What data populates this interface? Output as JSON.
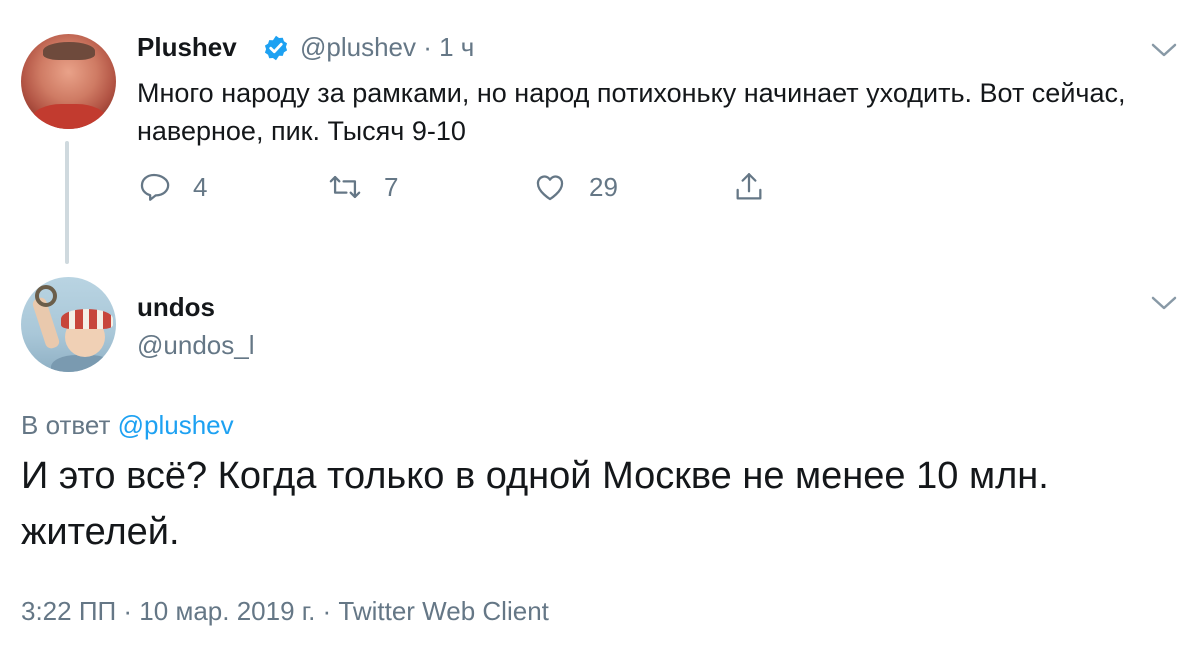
{
  "parent_tweet": {
    "author_name": "Plushev",
    "handle_time": "@plushev · 1 ч",
    "text": "Много народу за рамками, но народ потихоньку начинает уходить. Вот сейчас, наверное, пик. Тысяч 9-10",
    "replies": "4",
    "retweets": "7",
    "likes": "29"
  },
  "reply_tweet": {
    "author_name": "undos",
    "handle": "@undos_l",
    "reply_to_prefix": "В ответ",
    "reply_to_handle": "@plushev",
    "text": "И это всё? Когда только в одной Москве не менее 10 млн. жителей.",
    "meta": "3:22 ПП · 10 мар. 2019 г. · Twitter Web Client"
  },
  "colors": {
    "verified_badge": "#1da1f2",
    "link": "#1da1f2",
    "secondary_text": "#657786"
  },
  "icons": [
    "verified-badge-icon",
    "chevron-down-icon",
    "reply-icon",
    "retweet-icon",
    "like-icon",
    "share-icon"
  ]
}
